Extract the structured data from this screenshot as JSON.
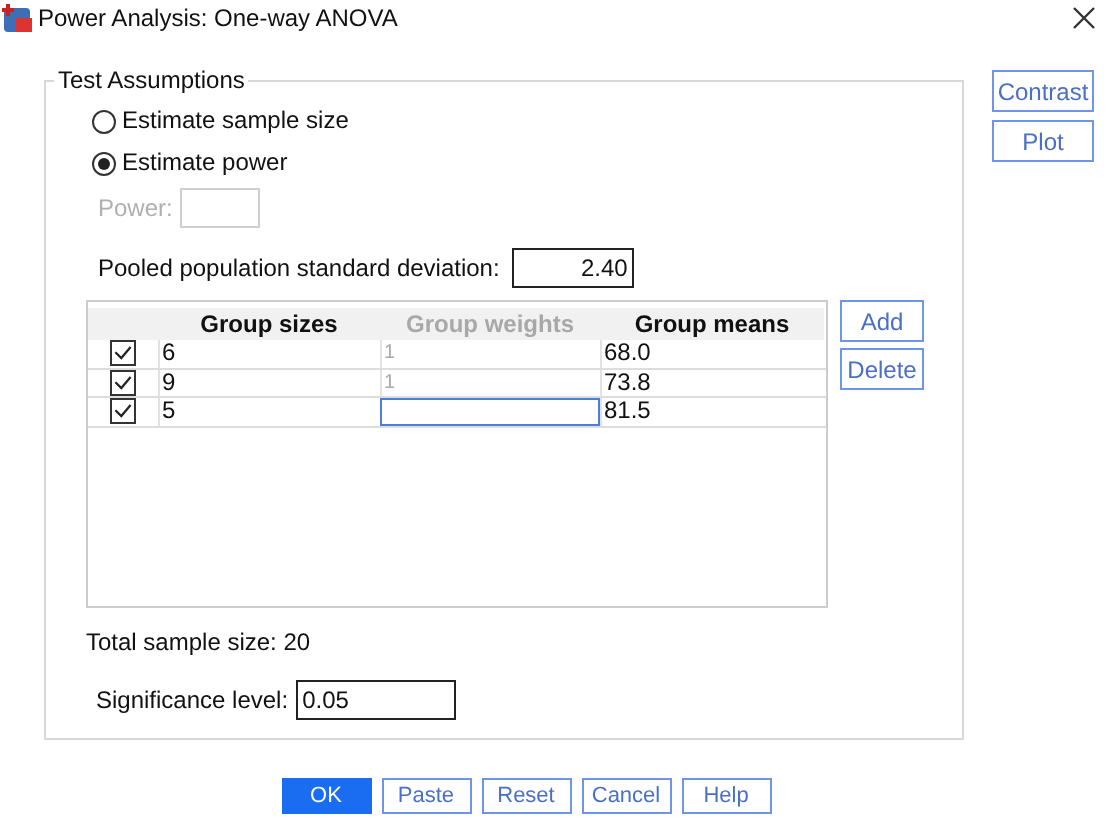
{
  "window": {
    "title": "Power Analysis: One-way ANOVA"
  },
  "test_assumptions": {
    "title": "Test Assumptions",
    "estimate_options": [
      {
        "label": "Estimate sample size",
        "selected": false
      },
      {
        "label": "Estimate power",
        "selected": true
      }
    ],
    "power": {
      "label": "Power:",
      "disabled": true
    },
    "pooled_sd": {
      "label": "Pooled population standard deviation:",
      "value": "2.40"
    },
    "group_table": {
      "columns": [
        {
          "label": "Group sizes",
          "disabled": false
        },
        {
          "label": "Group weights",
          "disabled": true
        },
        {
          "label": "Group means",
          "disabled": false
        }
      ],
      "rows": [
        {
          "checked": true,
          "size": "6",
          "weight": "1",
          "mean": "68.0",
          "weight_focused": false
        },
        {
          "checked": true,
          "size": "9",
          "weight": "1",
          "mean": "73.8",
          "weight_focused": false
        },
        {
          "checked": true,
          "size": "5",
          "mean": "81.5",
          "weight_focused": true
        }
      ],
      "buttons": [
        "Add",
        "Delete"
      ]
    },
    "total_sample_size": "Total sample size: 20",
    "significance": {
      "label": "Significance level:",
      "value": "0.05"
    }
  },
  "side_buttons": [
    "Contrast",
    "Plot"
  ],
  "footer_buttons": [
    {
      "label": "OK",
      "default": true
    },
    {
      "label": "Paste",
      "default": false
    },
    {
      "label": "Reset",
      "default": false
    },
    {
      "label": "Cancel",
      "default": false
    },
    {
      "label": "Help",
      "default": false
    }
  ]
}
